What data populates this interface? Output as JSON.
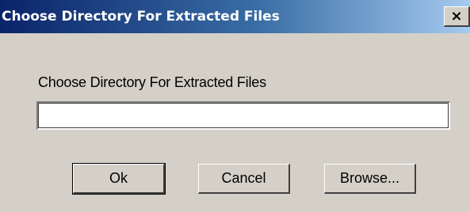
{
  "window": {
    "title": "Choose Directory For Extracted Files",
    "close_glyph": "×"
  },
  "form": {
    "label": "Choose Directory For Extracted Files",
    "directory_value": "",
    "directory_placeholder": ""
  },
  "buttons": {
    "ok_label": "Ok",
    "cancel_label": "Cancel",
    "browse_label": "Browse..."
  },
  "colors": {
    "title_gradient_start": "#0a246a",
    "title_gradient_end": "#a6caf0",
    "dialog_face": "#d4d0c8"
  }
}
